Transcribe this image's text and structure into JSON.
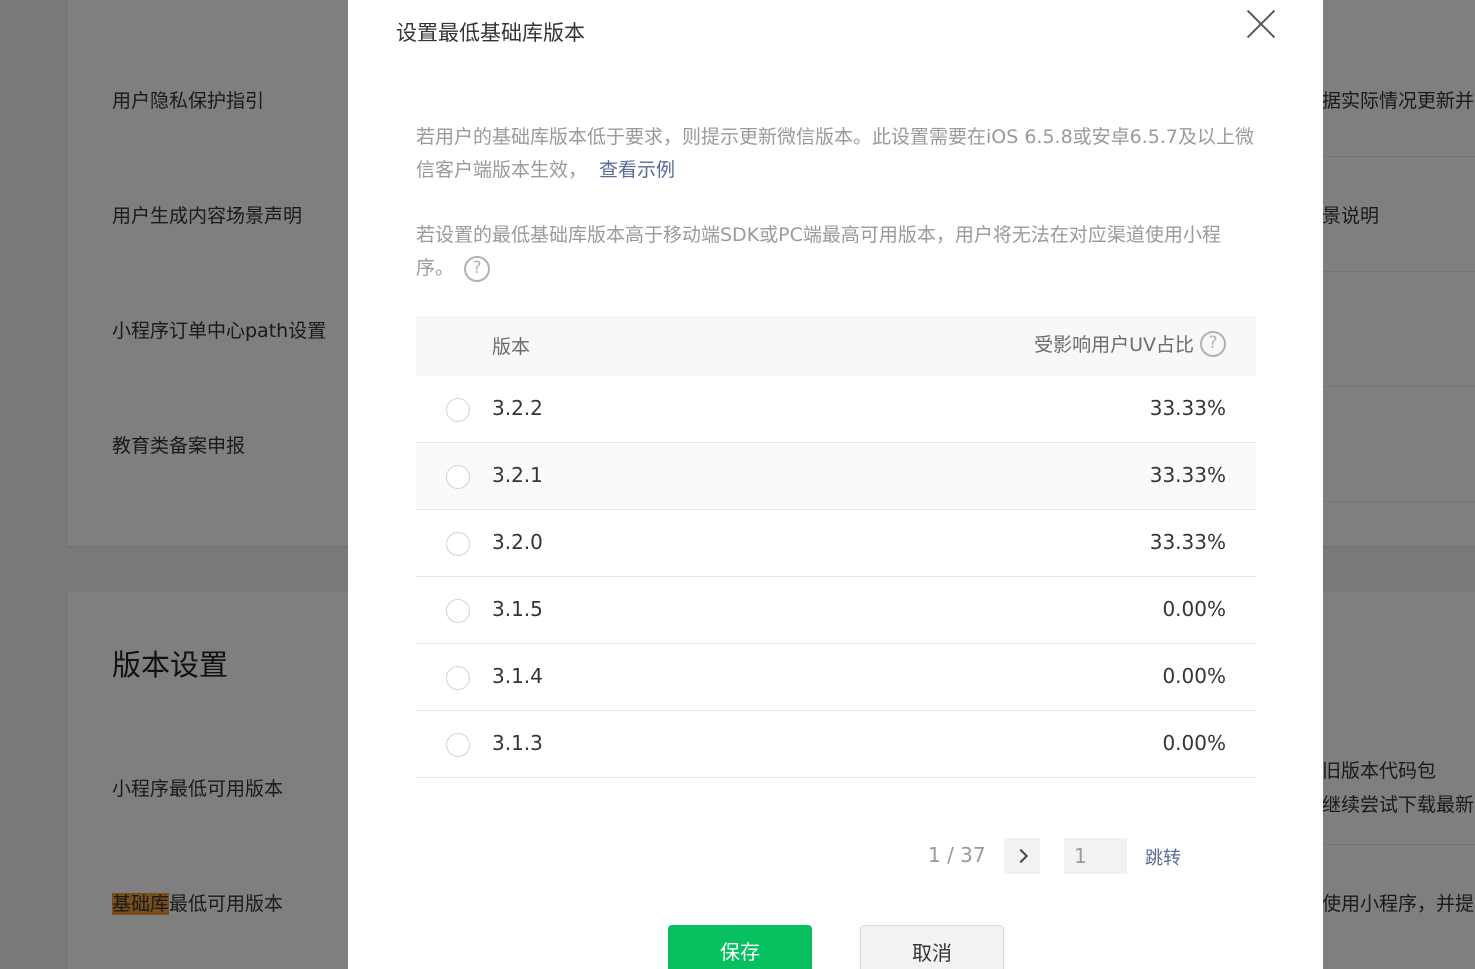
{
  "background": {
    "rows_top": [
      {
        "label": "用户隐私保护指引",
        "right": "据实际情况更新并"
      },
      {
        "label": "用户生成内容场景声明",
        "right": "景说明"
      },
      {
        "label": "小程序订单中心path设置",
        "right": ""
      },
      {
        "label": "教育类备案申报",
        "right": ""
      }
    ],
    "section_title": "版本设置",
    "rows_bottom": [
      {
        "label": "小程序最低可用版本",
        "right_line1": "旧版本代码包",
        "right_line2": "继续尝试下载最新"
      },
      {
        "label_highlight": "基础库",
        "label_rest": "最低可用版本",
        "right": "使用小程序，并提"
      }
    ]
  },
  "dialog": {
    "title": "设置最低基础库版本",
    "desc1": "若用户的基础库版本低于要求，则提示更新微信版本。此设置需要在iOS 6.5.8或安卓6.5.7及以上微信客户端版本生效，",
    "desc1_link": "查看示例",
    "desc2": "若设置的最低基础库版本高于移动端SDK或PC端最高可用版本，用户将无法在对应渠道使用小程序。",
    "help_glyph": "?",
    "table": {
      "col_version": "版本",
      "col_uv": "受影响用户UV占比",
      "rows": [
        {
          "version": "3.2.2",
          "uv": "33.33%"
        },
        {
          "version": "3.2.1",
          "uv": "33.33%"
        },
        {
          "version": "3.2.0",
          "uv": "33.33%"
        },
        {
          "version": "3.1.5",
          "uv": "0.00%"
        },
        {
          "version": "3.1.4",
          "uv": "0.00%"
        },
        {
          "version": "3.1.3",
          "uv": "0.00%"
        }
      ]
    },
    "pager": {
      "info": "1 / 37",
      "input_value": "1",
      "jump": "跳转"
    },
    "save": "保存",
    "cancel": "取消"
  }
}
